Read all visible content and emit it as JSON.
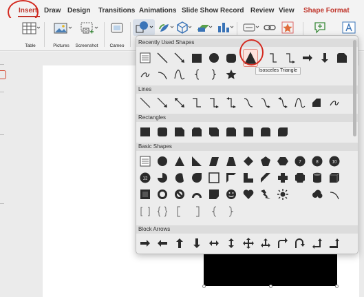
{
  "ribbon_tabs": [
    "Insert",
    "Draw",
    "Design",
    "Transitions",
    "Animations",
    "Slide Show",
    "Record",
    "Review",
    "View",
    "Shape Format"
  ],
  "ribbon_buttons": {
    "table": "Table",
    "pictures": "Pictures",
    "screenshot": "Screenshot",
    "cameo": "Cameo"
  },
  "shapes_panel": {
    "sections": [
      "Recently Used Shapes",
      "Lines",
      "Rectangles",
      "Basic Shapes",
      "Block Arrows"
    ],
    "tooltip": "Isosceles Triangle",
    "selected_shape": "isosceles-triangle"
  },
  "colors": {
    "accent": "#c0362c",
    "annotation": "#d42a20",
    "shape_fill": "#2b2b2b"
  }
}
